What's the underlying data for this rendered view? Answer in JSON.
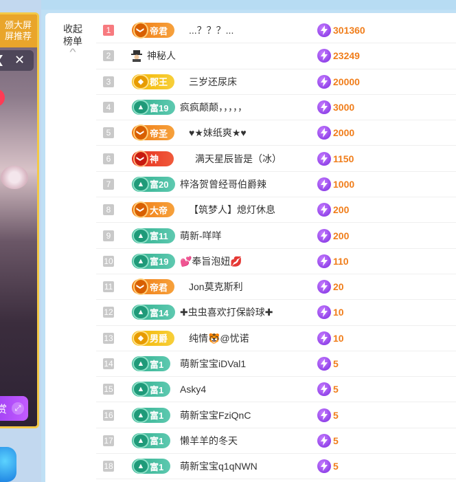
{
  "left_panel": {
    "promo_line1": "颁大屏",
    "promo_line2": "屏推荐",
    "close_symbol": "✕",
    "arrow_symbol": "❮",
    "gift_button_label": "赏",
    "expand_icon": "expand-icon"
  },
  "ranking": {
    "collapse_label_1": "收起",
    "collapse_label_2": "榜单",
    "rows": [
      {
        "rank": "1",
        "badge": "帝君",
        "badge_style": "orange",
        "name": "...？？？...",
        "score": "301360"
      },
      {
        "rank": "2",
        "badge": "",
        "badge_style": "none",
        "name": "神秘人",
        "score": "23249"
      },
      {
        "rank": "3",
        "badge": "郡王",
        "badge_style": "gold",
        "name": "三岁还尿床",
        "score": "20000"
      },
      {
        "rank": "4",
        "badge": "富19",
        "badge_style": "teal",
        "name": "疯疯颠颠，，，，，",
        "score": "3000"
      },
      {
        "rank": "5",
        "badge": "帝圣",
        "badge_style": "orange",
        "name": "♥★妹纸爽★♥",
        "score": "2000"
      },
      {
        "rank": "6",
        "badge": "神",
        "badge_style": "red",
        "name": "满天星辰皆是（冰）",
        "score": "1150"
      },
      {
        "rank": "7",
        "badge": "富20",
        "badge_style": "teal",
        "name": "梓洛贺曾经哥伯爵辣",
        "score": "1000"
      },
      {
        "rank": "8",
        "badge": "大帝",
        "badge_style": "orange",
        "name": "【筑梦人】熄灯休息",
        "score": "200"
      },
      {
        "rank": "9",
        "badge": "富11",
        "badge_style": "teal",
        "name": "萌新-咩咩",
        "score": "200"
      },
      {
        "rank": "10",
        "badge": "富19",
        "badge_style": "teal",
        "name": "💕奉旨泡妞💋",
        "score": "110"
      },
      {
        "rank": "11",
        "badge": "帝君",
        "badge_style": "orange",
        "name": "Jon莫克斯利",
        "score": "20"
      },
      {
        "rank": "12",
        "badge": "富14",
        "badge_style": "teal",
        "name": "✚虫虫喜欢打保龄球✚",
        "score": "10"
      },
      {
        "rank": "13",
        "badge": "男爵",
        "badge_style": "gold",
        "name": "纯情🐯@忧诺",
        "score": "10"
      },
      {
        "rank": "14",
        "badge": "富1",
        "badge_style": "teal",
        "name": "萌新宝宝iDVal1",
        "score": "5"
      },
      {
        "rank": "15",
        "badge": "富1",
        "badge_style": "teal",
        "name": "Asky4",
        "score": "5"
      },
      {
        "rank": "16",
        "badge": "富1",
        "badge_style": "teal",
        "name": "萌新宝宝FziQnC",
        "score": "5"
      },
      {
        "rank": "17",
        "badge": "富1",
        "badge_style": "teal",
        "name": "懒羊羊的冬天",
        "score": "5"
      },
      {
        "rank": "18",
        "badge": "富1",
        "badge_style": "teal",
        "name": "萌新宝宝q1qNWN",
        "score": "5"
      }
    ]
  },
  "colors": {
    "score": "#f07d1a",
    "rank_top": "#f77a7f",
    "rank_default": "#c9c9c9",
    "panel_bg": "#ffffff",
    "page_bg": "#bfe0f5"
  }
}
